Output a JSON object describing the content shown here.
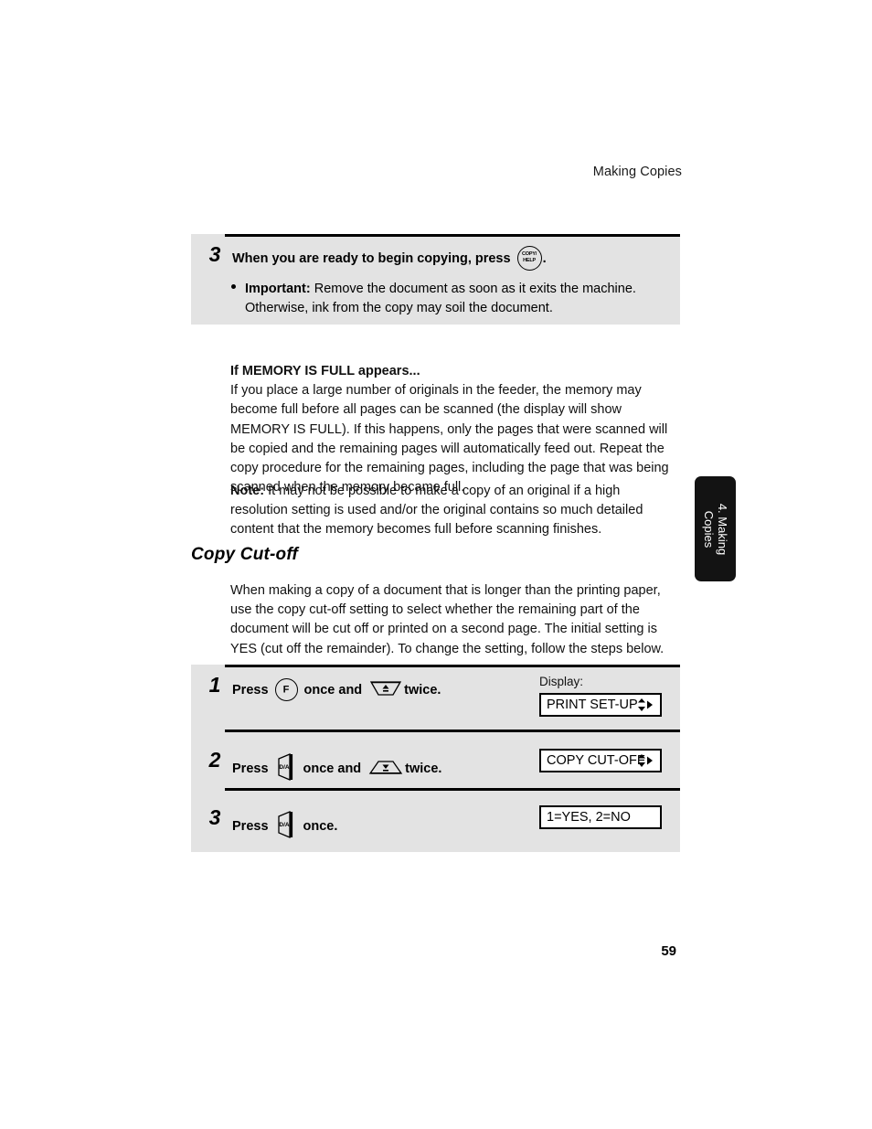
{
  "header": {
    "running_head": "Making Copies"
  },
  "side_tab": {
    "line1": "4. Making",
    "line2": "Copies"
  },
  "top_panel": {
    "step_number": "3",
    "instruction_before_icon": "When you are ready to begin copying, press",
    "instruction_after_icon": ".",
    "icon_name": "copy-help-key",
    "icon_line1": "COPY/",
    "icon_line2": "HELP",
    "bullet_label": "Important:",
    "bullet_text": " Remove the document as soon as it exits the machine. Otherwise, ink from the copy may soil the document."
  },
  "memory_section": {
    "heading": "If MEMORY IS FULL appears...",
    "body": "If you place a large number of originals in the feeder, the memory may become full before all pages can be scanned (the display will show MEMORY IS FULL). If this happens, only the pages that were scanned will be copied and the remaining pages will automatically feed out. Repeat the copy procedure for the remaining pages, including the page that was being scanned when the memory became full."
  },
  "note_section": {
    "label": "Note:",
    "body": " It may not be possible to make a copy of an original if a high resolution setting is used and/or the original contains so much detailed content that the memory becomes full before scanning finishes."
  },
  "section": {
    "title": "Copy Cut-off",
    "paragraph": "When making a copy of a document that is longer than the printing paper, use the copy cut-off setting to select whether the remaining part of the document will be cut off or printed on a second page. The initial setting is YES (cut off the remainder). To change the setting, follow the steps below."
  },
  "steps": [
    {
      "number": "1",
      "text_press": "Press",
      "icon1": "function-key",
      "icon1_label": "F",
      "text_mid": "once and",
      "icon2": "down-arrow-key",
      "text_end": "twice.",
      "display_label": "Display:",
      "display_value": "PRINT SET-UP",
      "display_has_arrows": true
    },
    {
      "number": "2",
      "text_press": "Press",
      "icon1": "start-key",
      "icon1_label": "D/A",
      "text_mid": "once and",
      "icon2": "up-arrow-key",
      "text_end": "twice.",
      "display_label": "",
      "display_value": "COPY CUT-OFF",
      "display_has_arrows": true
    },
    {
      "number": "3",
      "text_press": "Press",
      "icon1": "start-key",
      "icon1_label": "D/A",
      "text_mid": "",
      "icon2": "",
      "text_end": "once.",
      "display_label": "",
      "display_value": "1=YES, 2=NO",
      "display_has_arrows": false
    }
  ],
  "footer": {
    "page_number": "59"
  },
  "colors": {
    "panel_gray": "#e3e3e3",
    "tab_black": "#131313",
    "text_black": "#000000"
  }
}
